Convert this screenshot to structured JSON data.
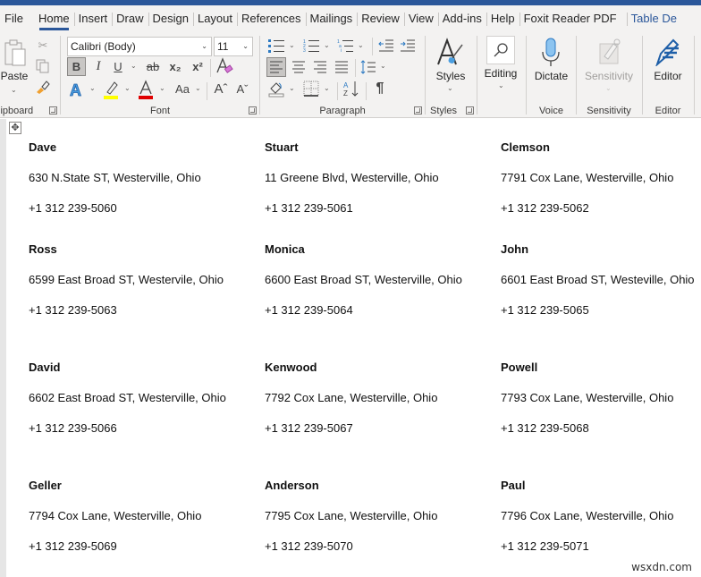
{
  "tabs": {
    "file": "File",
    "items": [
      "Home",
      "Insert",
      "Draw",
      "Design",
      "Layout",
      "References",
      "Mailings",
      "Review",
      "View",
      "Add-ins",
      "Help",
      "Foxit Reader PDF"
    ],
    "active": "Home",
    "contextual": "Table De"
  },
  "ribbon": {
    "clipboard": {
      "paste_label": "Paste",
      "group_label": "lipboard"
    },
    "font": {
      "font_name": "Calibri (Body)",
      "font_size": "11",
      "group_label": "Font",
      "bold": "B",
      "italic": "I",
      "underline": "U",
      "strike": "ab",
      "subscript": "x₂",
      "superscript": "x²",
      "change_case": "Aa",
      "grow": "Aˆ",
      "shrink": "Aˇ",
      "highlight_color": "#ffff00",
      "font_color": "#e00000"
    },
    "paragraph": {
      "group_label": "Paragraph",
      "pilcrow": "¶"
    },
    "styles": {
      "label": "Styles",
      "group_label": "Styles"
    },
    "editing": {
      "label": "Editing"
    },
    "voice": {
      "label": "Dictate",
      "group_label": "Voice"
    },
    "sensitivity": {
      "label": "Sensitivity",
      "group_label": "Sensitivity"
    },
    "editor": {
      "label": "Editor",
      "group_label": "Editor"
    }
  },
  "document": {
    "rows": [
      [
        {
          "name": "Dave",
          "address": "630 N.State ST, Westerville, Ohio",
          "phone": "+1 312 239-5060"
        },
        {
          "name": "Stuart",
          "address": "11 Greene Blvd, Westerville, Ohio",
          "phone": "+1 312 239-5061"
        },
        {
          "name": "Clemson",
          "address": "7791 Cox Lane, Westerville, Ohio",
          "phone": "+1 312 239-5062"
        }
      ],
      [
        {
          "name": "Ross",
          "address": "6599 East Broad ST, Westervile, Ohio",
          "phone": "+1 312 239-5063"
        },
        {
          "name": "Monica",
          "address": "6600 East Broad ST, Westerville, Ohio",
          "phone": "+1 312 239-5064"
        },
        {
          "name": "John",
          "address": "6601 East Broad ST, Westeville, Ohio",
          "phone": "+1 312 239-5065"
        }
      ],
      [
        {
          "name": "David",
          "address": "6602 East Broad ST, Westerville, Ohio",
          "phone": "+1 312 239-5066"
        },
        {
          "name": "Kenwood",
          "address": "7792 Cox Lane, Westerville, Ohio",
          "phone": "+1 312 239-5067"
        },
        {
          "name": "Powell",
          "address": "7793 Cox Lane, Westerville, Ohio",
          "phone": "+1 312 239-5068"
        }
      ],
      [
        {
          "name": "Geller",
          "address": "7794 Cox Lane, Westerville, Ohio",
          "phone": "+1 312 239-5069"
        },
        {
          "name": "Anderson",
          "address": "7795 Cox Lane, Westerville, Ohio",
          "phone": "+1 312 239-5070"
        },
        {
          "name": "Paul",
          "address": "7796 Cox Lane, Westerville, Ohio",
          "phone": "+1 312 239-5071"
        }
      ]
    ]
  },
  "watermark": "wsxdn.com"
}
